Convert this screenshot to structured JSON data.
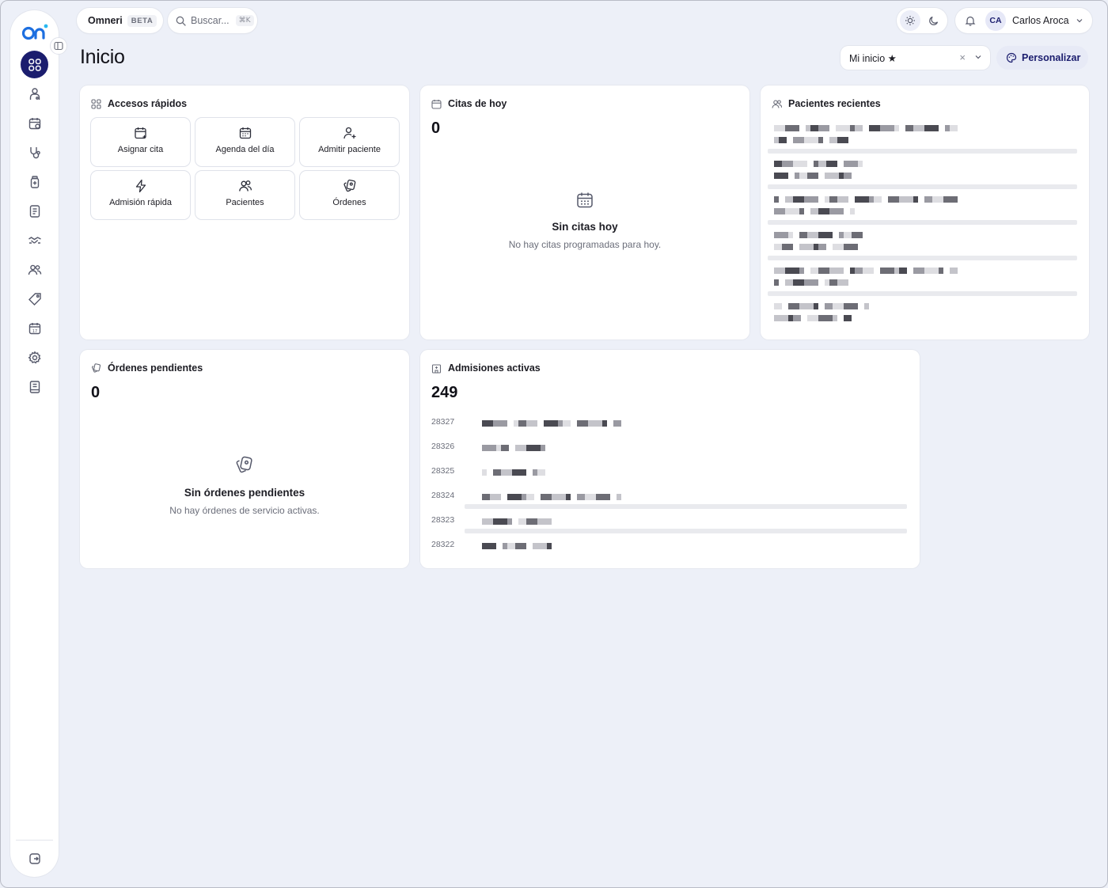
{
  "app": {
    "brand": "Omneri",
    "beta": "BETA",
    "search_placeholder": "Buscar...",
    "search_shortcut": "⌘K"
  },
  "user": {
    "initials": "CA",
    "name": "Carlos Aroca"
  },
  "page": {
    "title": "Inicio",
    "view_select": "Mi inicio ★",
    "view_clear": "×",
    "customize": "Personalizar"
  },
  "sidebar": {
    "items": [
      {
        "icon": "dashboard-grid-icon",
        "active": true
      },
      {
        "icon": "patient-icon",
        "active": false
      },
      {
        "icon": "calendar-check-icon",
        "active": false
      },
      {
        "icon": "stethoscope-icon",
        "active": false
      },
      {
        "icon": "medicine-bottle-icon",
        "active": false
      },
      {
        "icon": "document-icon",
        "active": false
      },
      {
        "icon": "handshake-icon",
        "active": false
      },
      {
        "icon": "users-icon",
        "active": false
      },
      {
        "icon": "tag-icon",
        "active": false
      },
      {
        "icon": "calendar-17-icon",
        "active": false
      },
      {
        "icon": "settings-icon",
        "active": false
      },
      {
        "icon": "book-icon",
        "active": false
      }
    ],
    "bottom": {
      "icon": "logout-icon"
    }
  },
  "quick_access": {
    "title": "Accesos rápidos",
    "tiles": [
      {
        "label": "Asignar cita",
        "icon": "calendar-plus-icon"
      },
      {
        "label": "Agenda del día",
        "icon": "calendar-icon"
      },
      {
        "label": "Admitir paciente",
        "icon": "user-plus-icon"
      },
      {
        "label": "Admisión rápida",
        "icon": "lightning-icon"
      },
      {
        "label": "Pacientes",
        "icon": "users-icon"
      },
      {
        "label": "Órdenes",
        "icon": "orders-icon"
      }
    ]
  },
  "appointments": {
    "title": "Citas de hoy",
    "count": "0",
    "empty_title": "Sin citas hoy",
    "empty_sub": "No hay citas programadas para hoy."
  },
  "recent_patients": {
    "title": "Pacientes recientes",
    "rows": 6
  },
  "pending_orders": {
    "title": "Órdenes pendientes",
    "count": "0",
    "empty_title": "Sin órdenes pendientes",
    "empty_sub": "No hay órdenes de servicio activas."
  },
  "admissions": {
    "title": "Admisiones activas",
    "count": "249",
    "ids": [
      "28327",
      "28326",
      "28325",
      "28324",
      "28323",
      "28322"
    ]
  },
  "colors": {
    "accent": "#1b1d6e",
    "background": "#edf0f8",
    "logo_blue": "#1d6fe0"
  }
}
